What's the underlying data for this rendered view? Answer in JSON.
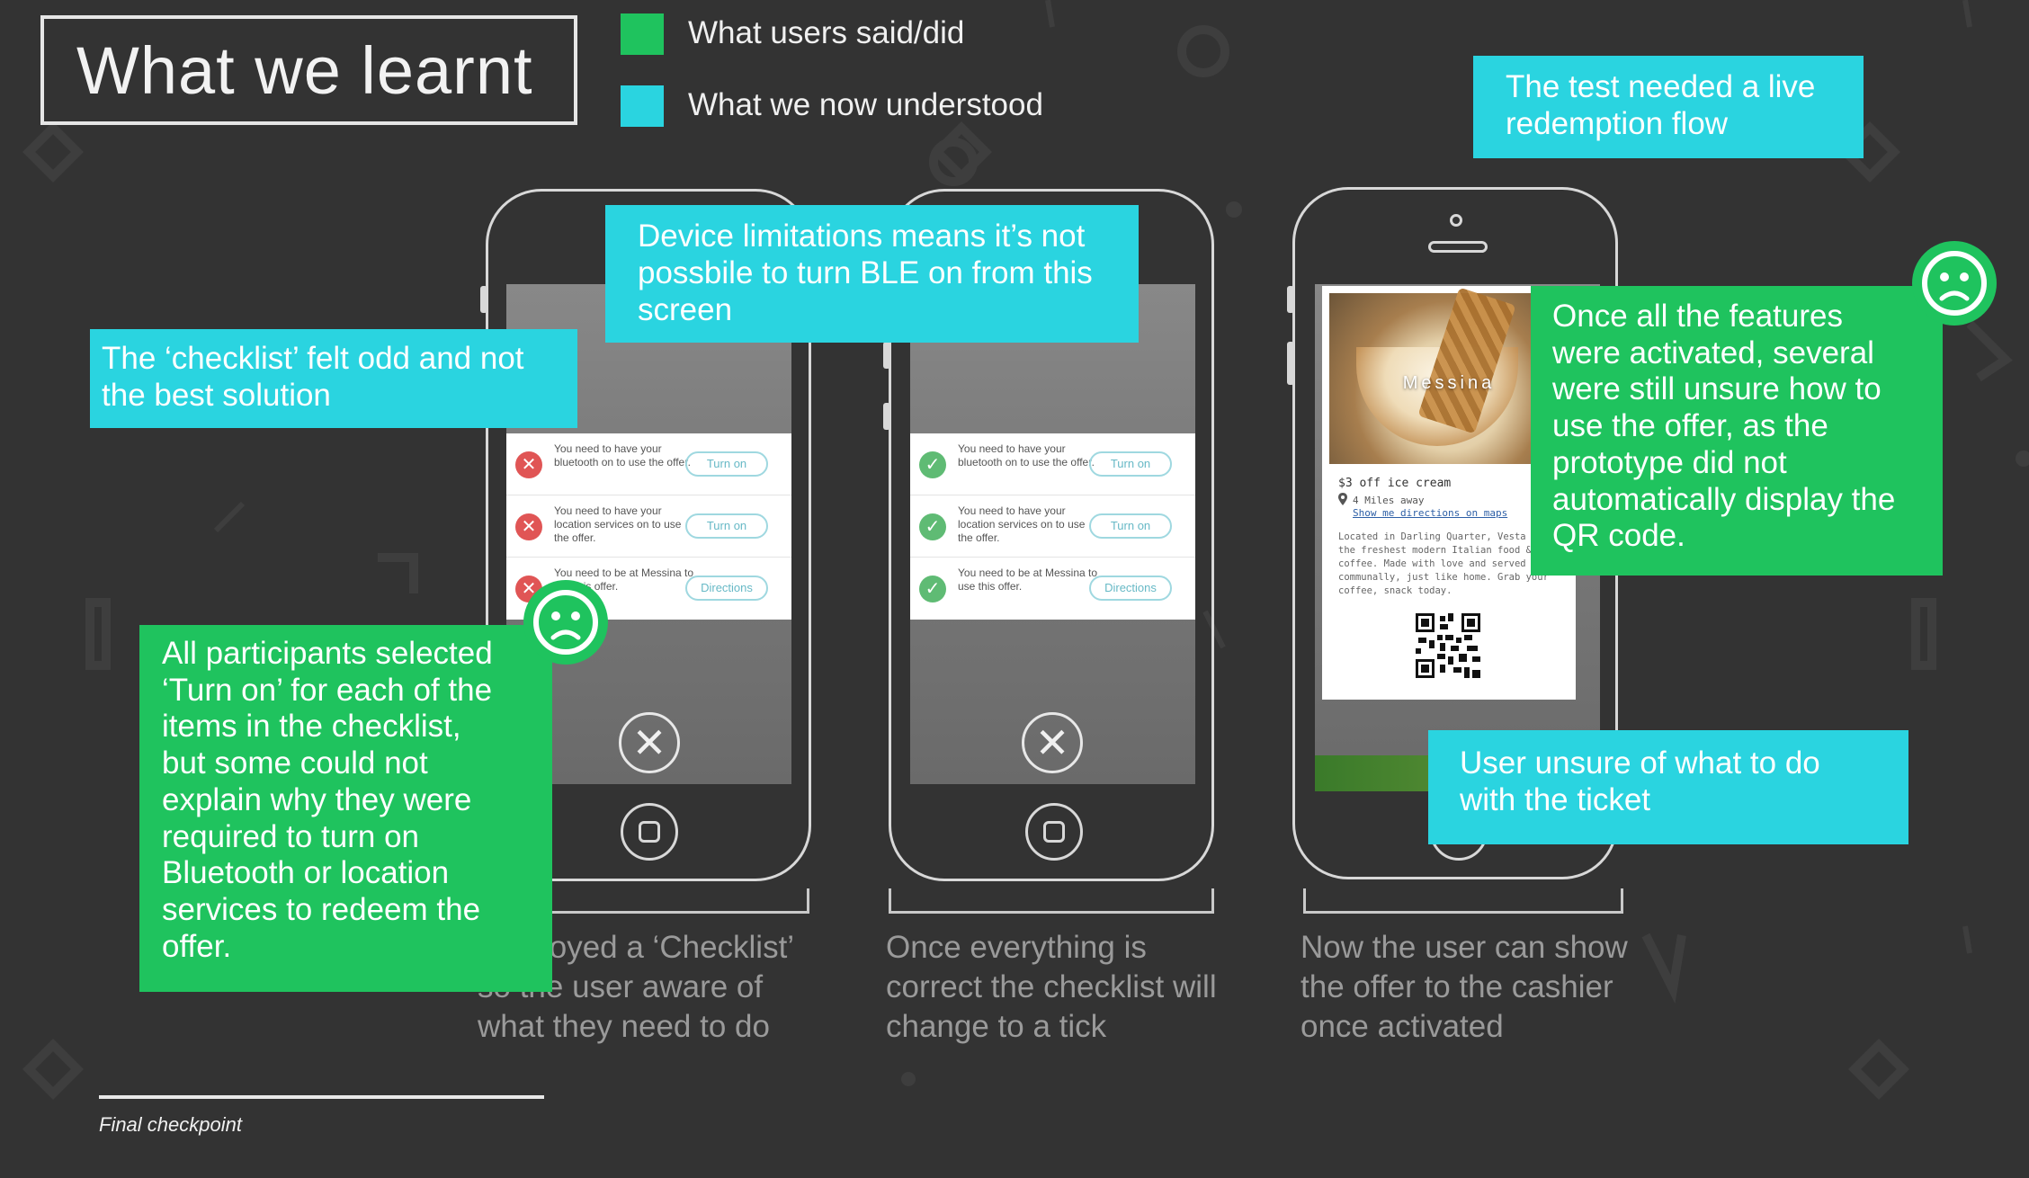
{
  "title": "What we learnt",
  "legend": [
    {
      "label": "What users said/did",
      "color": "#1fc35e"
    },
    {
      "label": "What we now understood",
      "color": "#2ad4e0"
    }
  ],
  "colors": {
    "background": "#333333",
    "green": "#1fc35e",
    "cyan": "#2ad4e0"
  },
  "phone1": {
    "checklist": [
      {
        "text": "You need to have your bluetooth on to use the offer.",
        "button": "Turn on",
        "status": "error"
      },
      {
        "text": "You need to have your location services on to use the offer.",
        "button": "Turn on",
        "status": "error"
      },
      {
        "text": "You need to be at Messina to use this offer.",
        "button": "Directions",
        "status": "error"
      }
    ],
    "caption": "Employed a ‘Checklist’\nso the user aware of\nwhat they need to do"
  },
  "phone2": {
    "checklist": [
      {
        "text": "You need to have your bluetooth on to use the offer.",
        "button": "Turn on",
        "status": "ok"
      },
      {
        "text": "You need to have your location services on to use the offer.",
        "button": "Turn on",
        "status": "ok"
      },
      {
        "text": "You need to be at Messina to use this offer.",
        "button": "Directions",
        "status": "ok"
      }
    ],
    "caption": "Once everything is\ncorrect the checklist will\nchange to a tick"
  },
  "phone3": {
    "ticket": {
      "brand": "Messina",
      "offer": "$3 off ice cream",
      "distance": "4 Miles away",
      "link": "Show me directions on maps",
      "description": "Located in Darling Quarter, Vesta has the freshest modern Italian food & coffee. Made with love and served communally, just like home. Grab your coffee, snack today."
    },
    "caption": "Now the user can show\nthe offer to the cashier\nonce activated"
  },
  "notes": {
    "checklist_odd": "The ‘checklist’ felt odd and not\nthe best solution",
    "device_limits": "Device limitations means it’s not\npossbile to turn BLE on from this\nscreen",
    "live_redemption": "The test needed a live\nredemption flow",
    "participants": "All participants selected\n‘Turn on’ for each of the\nitems in the checklist,\nbut some could not\nexplain why they were\nrequired to turn on\nBluetooth or location\nservices to redeem the\noffer.",
    "features_activated": "Once all the features\nwere activated, several\nwere still unsure how to\nuse the offer, as the\nprototype did not\nautomatically display the\nQR code.",
    "ticket_unsure": "User unsure of what to do\nwith the ticket"
  },
  "icons": {
    "sad_face": "sad-face-icon",
    "close": "close-icon",
    "check": "check-icon",
    "error": "error-x-icon",
    "home": "home-button-icon"
  },
  "footer": "Final checkpoint"
}
